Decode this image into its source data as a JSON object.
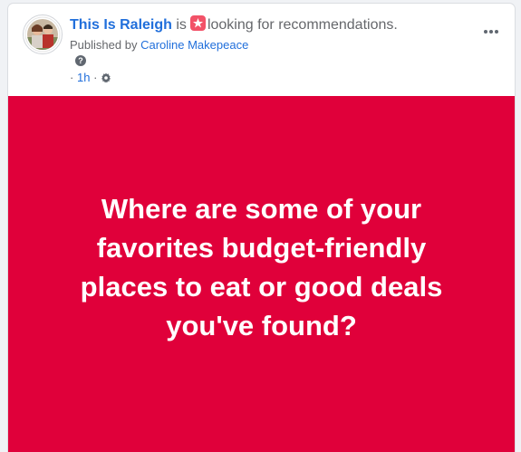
{
  "post": {
    "page_name": "This Is Raleigh",
    "is_word": "is",
    "activity_icon": "recommendation-icon",
    "activity_text": "looking for recommendations.",
    "published_by_prefix": "Published by",
    "publisher_name": "Caroline Makepeace",
    "help_mark": "?",
    "time_prefix": "·",
    "time": "1h",
    "time_suffix": "·",
    "privacy_icon": "gear-icon",
    "more_icon": "more-options-icon",
    "body_text": "Where are some of your favorites budget-friendly places to eat or good deals you've found?",
    "background_color": "#e0003a",
    "link_color": "#216fdb"
  }
}
